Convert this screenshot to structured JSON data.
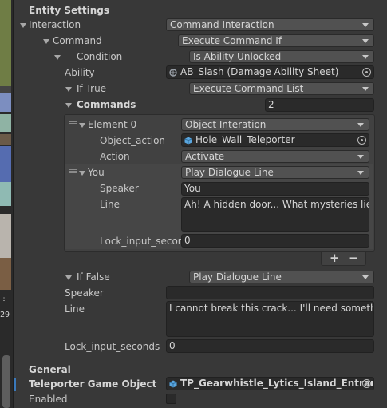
{
  "left_panel": {
    "glyph_dots": "⋮",
    "number_fragment": "29"
  },
  "header": {
    "title": "Entity Settings"
  },
  "interaction": {
    "label": "Interaction",
    "value": "Command Interaction"
  },
  "command": {
    "label": "Command",
    "value": "Execute Command If"
  },
  "condition": {
    "label": "Condition",
    "value": "Is Ability Unlocked"
  },
  "ability": {
    "label": "Ability",
    "value": "AB_Slash (Damage Ability Sheet)"
  },
  "if_true": {
    "label": "If True",
    "value": "Execute Command List"
  },
  "commands": {
    "label": "Commands",
    "count": "2",
    "element0": {
      "label": "Element 0",
      "value": "Object Interation",
      "object_action_label": "Object_action",
      "object_action_value": "Hole_Wall_Teleporter",
      "action_label": "Action",
      "action_value": "Activate"
    },
    "element1": {
      "label": "You",
      "value": "Play Dialogue Line",
      "speaker_label": "Speaker",
      "speaker_value": "You",
      "line_label": "Line",
      "line_value": "Ah! A hidden door... What mysteries lie be",
      "lock_label": "Lock_input_secon",
      "lock_value": "0"
    },
    "add_label": "+",
    "remove_label": "−"
  },
  "if_false": {
    "label": "If False",
    "value": "Play Dialogue Line",
    "speaker_label": "Speaker",
    "speaker_value": "",
    "line_label": "Line",
    "line_value": "I cannot break this crack... I'll need something",
    "lock_label": "Lock_input_seconds",
    "lock_value": "0"
  },
  "general": {
    "title": "General",
    "teleporter_label": "Teleporter Game Object",
    "teleporter_value": "TP_Gearwhistle_Lytics_Island_Entrance",
    "enabled_label": "Enabled",
    "enabled": false
  },
  "colors": {
    "accent": "#3a79bb",
    "field_bg": "#2a2a2a",
    "dropdown_bg": "#515151",
    "panel_bg": "#383838"
  },
  "icons": [
    "scriptable-object-icon",
    "prefab-cube-icon",
    "object-picker-icon",
    "foldout-arrow-icon",
    "drag-handle-icon",
    "dropdown-caret-icon"
  ]
}
